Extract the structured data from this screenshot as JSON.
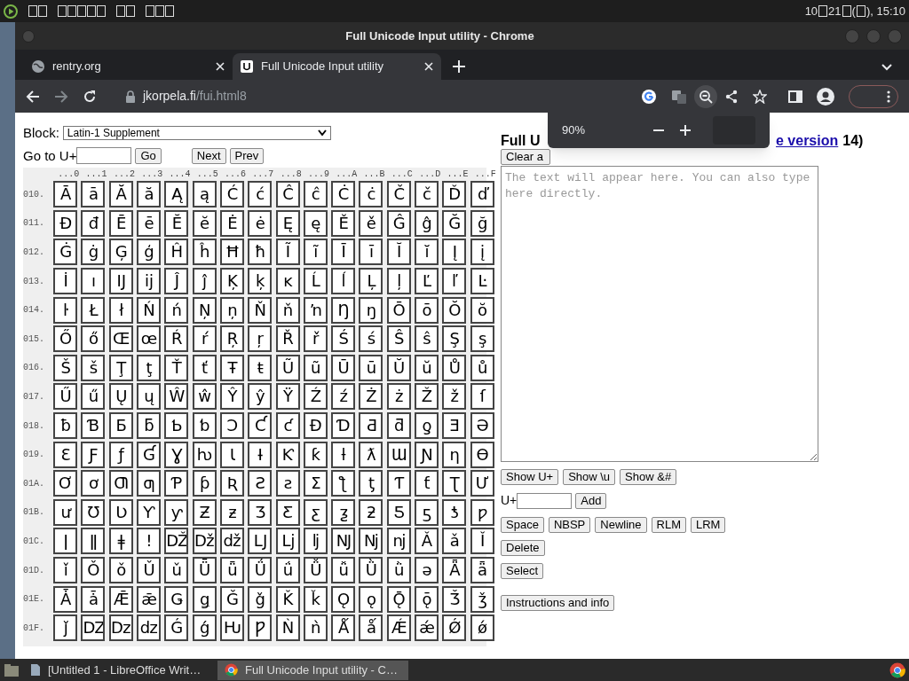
{
  "top_bar": {
    "clock_parts": [
      "10",
      "21",
      "(",
      "), 15:10"
    ]
  },
  "window": {
    "title": "Full Unicode Input utility - Chrome"
  },
  "tabs": [
    {
      "label": "rentry.org",
      "selected": false
    },
    {
      "label": "Full Unicode Input utility",
      "selected": true
    }
  ],
  "address_bar": {
    "host": "jkorpela.fi",
    "path": "/fui.html8"
  },
  "zoom_popup": {
    "reading": "90%"
  },
  "page": {
    "block_label": "Block:",
    "block_value": "Latin-1 Supplement",
    "goto_label": "Go to U+",
    "go_button": "Go",
    "next_button": "Next",
    "prev_button": "Prev",
    "column_headings": [
      "...0",
      "...1",
      "...2",
      "...3",
      "...4",
      "...5",
      "...6",
      "...7",
      "...8",
      "...9",
      "...A",
      "...B",
      "...C",
      "...D",
      "...E",
      "...F"
    ],
    "rows": [
      {
        "label": "010.",
        "cells": [
          "Ā",
          "ā",
          "Ă",
          "ă",
          "Ą",
          "ą",
          "Ć",
          "ć",
          "Ĉ",
          "ĉ",
          "Ċ",
          "ċ",
          "Č",
          "č",
          "Ď",
          "ď"
        ]
      },
      {
        "label": "011.",
        "cells": [
          "Đ",
          "đ",
          "Ē",
          "ē",
          "Ĕ",
          "ĕ",
          "Ė",
          "ė",
          "Ę",
          "ę",
          "Ě",
          "ě",
          "Ĝ",
          "ĝ",
          "Ğ",
          "ğ"
        ]
      },
      {
        "label": "012.",
        "cells": [
          "Ġ",
          "ġ",
          "Ģ",
          "ģ",
          "Ĥ",
          "ĥ",
          "Ħ",
          "ħ",
          "Ĩ",
          "ĩ",
          "Ī",
          "ī",
          "Ĭ",
          "ĭ",
          "Į",
          "į"
        ]
      },
      {
        "label": "013.",
        "cells": [
          "İ",
          "ı",
          "Ĳ",
          "ĳ",
          "Ĵ",
          "ĵ",
          "Ķ",
          "ķ",
          "ĸ",
          "Ĺ",
          "ĺ",
          "Ļ",
          "ļ",
          "Ľ",
          "ľ",
          "Ŀ"
        ]
      },
      {
        "label": "014.",
        "cells": [
          "ŀ",
          "Ł",
          "ł",
          "Ń",
          "ń",
          "Ņ",
          "ņ",
          "Ň",
          "ň",
          "ŉ",
          "Ŋ",
          "ŋ",
          "Ō",
          "ō",
          "Ŏ",
          "ŏ"
        ]
      },
      {
        "label": "015.",
        "cells": [
          "Ő",
          "ő",
          "Œ",
          "œ",
          "Ŕ",
          "ŕ",
          "Ŗ",
          "ŗ",
          "Ř",
          "ř",
          "Ś",
          "ś",
          "Ŝ",
          "ŝ",
          "Ş",
          "ş"
        ]
      },
      {
        "label": "016.",
        "cells": [
          "Š",
          "š",
          "Ţ",
          "ţ",
          "Ť",
          "ť",
          "Ŧ",
          "ŧ",
          "Ũ",
          "ũ",
          "Ū",
          "ū",
          "Ŭ",
          "ŭ",
          "Ů",
          "ů"
        ]
      },
      {
        "label": "017.",
        "cells": [
          "Ű",
          "ű",
          "Ų",
          "ų",
          "Ŵ",
          "ŵ",
          "Ŷ",
          "ŷ",
          "Ÿ",
          "Ź",
          "ź",
          "Ż",
          "ż",
          "Ž",
          "ž",
          "ſ"
        ]
      },
      {
        "label": "018.",
        "cells": [
          "ƀ",
          "Ɓ",
          "Ƃ",
          "ƃ",
          "Ƅ",
          "ƅ",
          "Ɔ",
          "Ƈ",
          "ƈ",
          "Ɖ",
          "Ɗ",
          "Ƌ",
          "ƌ",
          "ƍ",
          "Ǝ",
          "Ə"
        ]
      },
      {
        "label": "019.",
        "cells": [
          "Ɛ",
          "Ƒ",
          "ƒ",
          "Ɠ",
          "Ɣ",
          "ƕ",
          "Ɩ",
          "Ɨ",
          "Ƙ",
          "ƙ",
          "ƚ",
          "ƛ",
          "Ɯ",
          "Ɲ",
          "ƞ",
          "Ɵ"
        ]
      },
      {
        "label": "01A.",
        "cells": [
          "Ơ",
          "ơ",
          "Ƣ",
          "ƣ",
          "Ƥ",
          "ƥ",
          "Ʀ",
          "Ƨ",
          "ƨ",
          "Ʃ",
          "ƪ",
          "ƫ",
          "Ƭ",
          "ƭ",
          "Ʈ",
          "Ư"
        ]
      },
      {
        "label": "01B.",
        "cells": [
          "ư",
          "Ʊ",
          "Ʋ",
          "Ƴ",
          "ƴ",
          "Ƶ",
          "ƶ",
          "Ʒ",
          "Ƹ",
          "ƹ",
          "ƺ",
          "ƻ",
          "Ƽ",
          "ƽ",
          "ƾ",
          "ƿ"
        ]
      },
      {
        "label": "01C.",
        "cells": [
          "ǀ",
          "ǁ",
          "ǂ",
          "ǃ",
          "Ǆ",
          "ǅ",
          "ǆ",
          "Ǉ",
          "ǈ",
          "ǉ",
          "Ǌ",
          "ǋ",
          "ǌ",
          "Ǎ",
          "ǎ",
          "Ǐ"
        ]
      },
      {
        "label": "01D.",
        "cells": [
          "ǐ",
          "Ǒ",
          "ǒ",
          "Ǔ",
          "ǔ",
          "Ǖ",
          "ǖ",
          "Ǘ",
          "ǘ",
          "Ǚ",
          "ǚ",
          "Ǜ",
          "ǜ",
          "ǝ",
          "Ǟ",
          "ǟ"
        ]
      },
      {
        "label": "01E.",
        "cells": [
          "Ǡ",
          "ǡ",
          "Ǣ",
          "ǣ",
          "Ǥ",
          "ǥ",
          "Ǧ",
          "ǧ",
          "Ǩ",
          "ǩ",
          "Ǫ",
          "ǫ",
          "Ǭ",
          "ǭ",
          "Ǯ",
          "ǯ"
        ]
      },
      {
        "label": "01F.",
        "cells": [
          "ǰ",
          "Ǳ",
          "ǲ",
          "ǳ",
          "Ǵ",
          "ǵ",
          "Ƕ",
          "Ƿ",
          "Ǹ",
          "ǹ",
          "Ǻ",
          "ǻ",
          "Ǽ",
          "ǽ",
          "Ǿ",
          "ǿ"
        ]
      }
    ],
    "heading_start": "Full U",
    "heading_link": "e version",
    "heading_end": "14)",
    "clear_button": "Clear a",
    "text_placeholder": "The text will appear here. You can also type here directly.",
    "show_buttons": [
      "Show U+",
      "Show \\u",
      "Show &#"
    ],
    "add_label": "U+",
    "add_button": "Add",
    "insert_buttons": [
      "Space",
      "NBSP",
      "Newline",
      "RLM",
      "LRM"
    ],
    "delete_button": "Delete",
    "select_button": "Select",
    "info_button": "Instructions and info"
  },
  "taskbar": {
    "items": [
      {
        "label": "[Untitled 1 - LibreOffice Writ…",
        "selected": false
      },
      {
        "label": "Full Unicode Input utility - C…",
        "selected": true
      }
    ]
  }
}
